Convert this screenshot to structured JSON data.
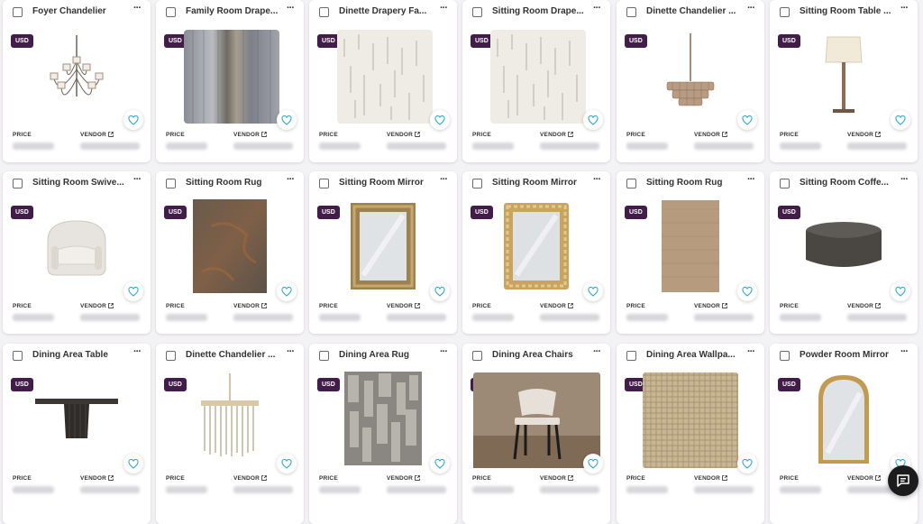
{
  "currency_badge": "USD",
  "price_label": "PRICE",
  "vendor_label": "VENDOR",
  "colors": {
    "badge": "#421d49",
    "heart": "#3aa7c9",
    "chat": "#1c1c1c"
  },
  "items": [
    {
      "title": "Foyer Chandelier",
      "icon": "chandelier-image"
    },
    {
      "title": "Family Room Drape...",
      "icon": "drapery-fabric-image"
    },
    {
      "title": "Dinette Drapery Fa...",
      "icon": "drapery-fabric-image"
    },
    {
      "title": "Sitting Room Drape...",
      "icon": "drapery-fabric-image"
    },
    {
      "title": "Dinette Chandelier ...",
      "icon": "tiered-chandelier-image"
    },
    {
      "title": "Sitting Room Table ...",
      "icon": "table-lamp-image"
    },
    {
      "title": "Sitting Room Swive...",
      "icon": "swivel-chair-image"
    },
    {
      "title": "Sitting Room Rug",
      "icon": "rug-image"
    },
    {
      "title": "Sitting Room Mirror",
      "icon": "mirror-image"
    },
    {
      "title": "Sitting Room Mirror",
      "icon": "mirror-image"
    },
    {
      "title": "Sitting Room Rug",
      "icon": "rug-image"
    },
    {
      "title": "Sitting Room Coffe...",
      "icon": "coffee-table-image"
    },
    {
      "title": "Dining Area Table",
      "icon": "dining-table-image"
    },
    {
      "title": "Dinette Chandelier ...",
      "icon": "drum-chandelier-image"
    },
    {
      "title": "Dining Area Rug",
      "icon": "rug-image"
    },
    {
      "title": "Dining Area Chairs",
      "icon": "dining-chair-image"
    },
    {
      "title": "Dining Area Wallpa...",
      "icon": "wallpaper-image"
    },
    {
      "title": "Powder Room Mirror",
      "icon": "arched-mirror-image"
    }
  ]
}
